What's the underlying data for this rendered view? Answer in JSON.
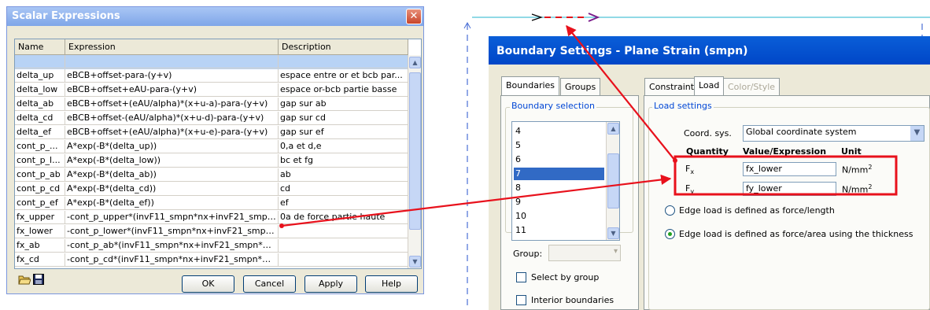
{
  "scalar_dialog": {
    "title": "Scalar Expressions",
    "close_symbol": "✕",
    "columns": [
      "Name",
      "Expression",
      "Description"
    ],
    "rows": [
      {
        "name": "",
        "expression": "",
        "description": ""
      },
      {
        "name": "delta_up",
        "expression": "eBCB+offset-para-(y+v)",
        "description": "espace entre or et bcb par..."
      },
      {
        "name": "delta_low",
        "expression": "eBCB+offset+eAU-para-(y+v)",
        "description": "espace or-bcb partie basse"
      },
      {
        "name": "delta_ab",
        "expression": "eBCB+offset+(eAU/alpha)*(x+u-a)-para-(y+v)",
        "description": "gap sur ab"
      },
      {
        "name": "delta_cd",
        "expression": "eBCB+offset-(eAU/alpha)*(x+u-d)-para-(y+v)",
        "description": "gap sur cd"
      },
      {
        "name": "delta_ef",
        "expression": "eBCB+offset+(eAU/alpha)*(x+u-e)-para-(y+v)",
        "description": "gap sur ef"
      },
      {
        "name": "cont_p_...",
        "expression": "A*exp(-B*(delta_up))",
        "description": "0,a et d,e"
      },
      {
        "name": "cont_p_l...",
        "expression": "A*exp(-B*(delta_low))",
        "description": "bc et fg"
      },
      {
        "name": "cont_p_ab",
        "expression": "A*exp(-B*(delta_ab))",
        "description": "ab"
      },
      {
        "name": "cont_p_cd",
        "expression": "A*exp(-B*(delta_cd))",
        "description": "cd"
      },
      {
        "name": "cont_p_ef",
        "expression": "A*exp(-B*(delta_ef))",
        "description": "ef"
      },
      {
        "name": "fx_upper",
        "expression": "-cont_p_upper*(invF11_smpn*nx+invF21_smpn...",
        "description": "0a de force partie haute"
      },
      {
        "name": "fx_lower",
        "expression": "-cont_p_lower*(invF11_smpn*nx+invF21_smpn...",
        "description": ""
      },
      {
        "name": "fx_ab",
        "expression": "-cont_p_ab*(invF11_smpn*nx+invF21_smpn*ny...",
        "description": ""
      },
      {
        "name": "fx_cd",
        "expression": "-cont_p_cd*(invF11_smpn*nx+invF21_smpn*ny...",
        "description": ""
      }
    ],
    "buttons": {
      "ok": "OK",
      "cancel": "Cancel",
      "apply": "Apply",
      "help": "Help"
    },
    "icons": {
      "open": "folder-open-icon",
      "save": "floppy-disk-icon"
    }
  },
  "boundary_dialog": {
    "title": "Boundary Settings - Plane Strain (smpn)",
    "left_tabs": [
      "Boundaries",
      "Groups"
    ],
    "right_tabs": [
      "Constraint",
      "Load",
      "Color/Style"
    ],
    "boundary_selection_label": "Boundary selection",
    "boundary_list": [
      "4",
      "5",
      "6",
      "7",
      "8",
      "9",
      "10",
      "11"
    ],
    "selected_boundary": "7",
    "group_label": "Group:",
    "group_value": "",
    "select_by_group": "Select by group",
    "interior_boundaries": "Interior boundaries",
    "load_settings_label": "Load settings",
    "coord_sys_label": "Coord. sys.",
    "coord_sys_value": "Global coordinate system",
    "col_quantity": "Quantity",
    "col_value": "Value/Expression",
    "col_unit": "Unit",
    "fx_label": "F",
    "fx_sub": "x",
    "fx_value": "fx_lower",
    "fy_label": "F",
    "fy_sub": "y",
    "fy_value": "fy_lower",
    "unit": "N/mm",
    "unit_sup": "2",
    "radio_force_length": "Edge load is defined as force/length",
    "radio_force_area": "Edge load is defined as force/area using the thickness",
    "selected_radio": "force_area"
  },
  "colors": {
    "annotation_red": "#e8111c",
    "geometry_cyan": "#4fc4d6",
    "geometry_dash_red": "#e0141c",
    "geometry_purple": "#7a1a8a",
    "axis_blue": "#4a6fd6"
  }
}
